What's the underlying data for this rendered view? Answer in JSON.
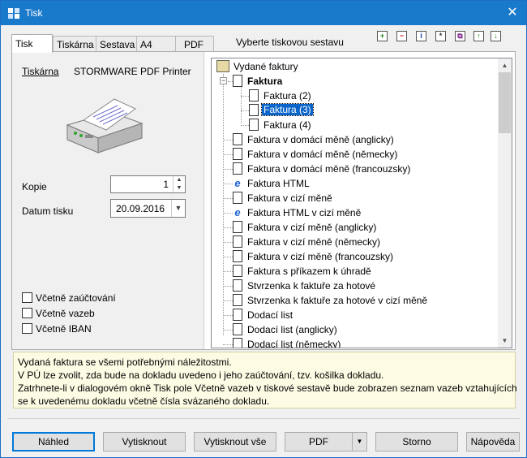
{
  "window": {
    "title": "Tisk",
    "close_glyph": "✕"
  },
  "tabs": [
    {
      "label": "Tisk",
      "active": true
    },
    {
      "label": "Tiskárna"
    },
    {
      "label": "Sestava"
    },
    {
      "label": "A4"
    },
    {
      "label": "PDF"
    }
  ],
  "left": {
    "printer_label": "Tiskárna",
    "printer_name": "STORMWARE PDF Printer",
    "copies_label": "Kopie",
    "copies_value": "1",
    "date_label": "Datum tisku",
    "date_value": "20.09.2016",
    "checkboxes": [
      {
        "label": "Včetně zaúčtování",
        "checked": false
      },
      {
        "label": "Včetně vazeb",
        "checked": false
      },
      {
        "label": "Včetně IBAN",
        "checked": false
      }
    ]
  },
  "right": {
    "section_title": "Vyberte tiskovou sestavu",
    "toolbar": [
      {
        "name": "add-icon",
        "glyph": "+",
        "color": "#1a8a1a"
      },
      {
        "name": "remove-icon",
        "glyph": "−",
        "color": "#c01010"
      },
      {
        "name": "info-icon",
        "glyph": "i",
        "color": "#1a3aa0"
      },
      {
        "name": "star-icon",
        "glyph": "*",
        "color": "#333333"
      },
      {
        "name": "copy-icon",
        "glyph": "⧉",
        "color": "#7a1a8a"
      },
      {
        "name": "move-up-icon",
        "glyph": "↑",
        "color": "#1a8a1a"
      },
      {
        "name": "move-down-icon",
        "glyph": "↓",
        "color": "#1a8a1a"
      }
    ],
    "tree": {
      "root": "Vydané faktury",
      "group": "Faktura",
      "children": [
        "Faktura (2)",
        "Faktura (3)",
        "Faktura (4)"
      ],
      "selected": "Faktura (3)",
      "items": [
        {
          "label": "Faktura v domácí měně (anglicky)",
          "icon": "doc"
        },
        {
          "label": "Faktura v domácí měně (německy)",
          "icon": "doc"
        },
        {
          "label": "Faktura v domácí měně (francouzsky)",
          "icon": "doc"
        },
        {
          "label": "Faktura HTML",
          "icon": "ie"
        },
        {
          "label": "Faktura v cizí měně",
          "icon": "doc"
        },
        {
          "label": "Faktura HTML v cizí měně",
          "icon": "ie"
        },
        {
          "label": "Faktura v cizí měně (anglicky)",
          "icon": "doc"
        },
        {
          "label": "Faktura v cizí měně (německy)",
          "icon": "doc"
        },
        {
          "label": "Faktura v cizí měně (francouzsky)",
          "icon": "doc"
        },
        {
          "label": "Faktura s příkazem k úhradě",
          "icon": "doc"
        },
        {
          "label": "Stvrzenka k faktuře za hotové",
          "icon": "doc"
        },
        {
          "label": "Stvrzenka k faktuře za hotové v cizí měně",
          "icon": "doc"
        },
        {
          "label": "Dodací list",
          "icon": "doc"
        },
        {
          "label": "Dodací list (anglicky)",
          "icon": "doc"
        },
        {
          "label": "Dodací list (německy)",
          "icon": "doc"
        }
      ]
    }
  },
  "description": [
    "Vydaná faktura se všemi potřebnými náležitostmi.",
    "V PÚ lze zvolit, zda bude na dokladu uvedeno i jeho zaúčtování, tzv. košilka dokladu.",
    "Zatrhnete-li v dialogovém okně Tisk pole Včetně vazeb v tiskové sestavě bude zobrazen seznam vazeb vztahujících",
    "se k uvedenému dokladu včetně čísla svázaného dokladu."
  ],
  "buttons": {
    "preview": "Náhled",
    "print": "Vytisknout",
    "print_all": "Vytisknout vše",
    "pdf": "PDF",
    "cancel": "Storno",
    "help": "Nápověda"
  }
}
